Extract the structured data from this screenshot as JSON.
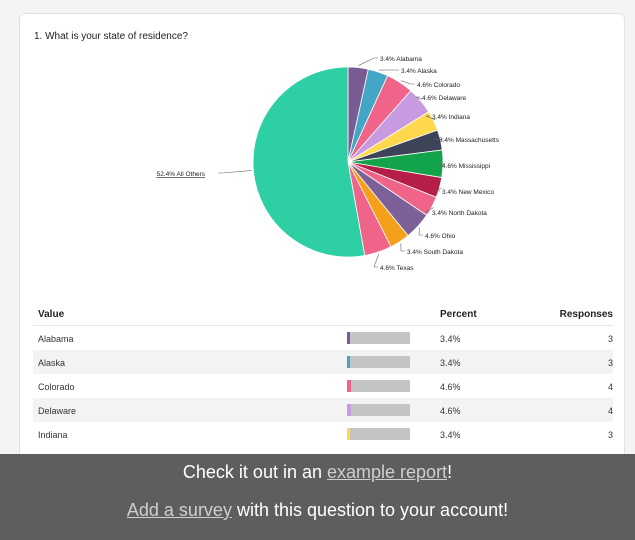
{
  "question": {
    "title": "1. What is your state of residence?"
  },
  "chart_data": {
    "type": "pie",
    "title": "1. What is your state of residence?",
    "slices": [
      {
        "label": "Alabama",
        "value": 3.4,
        "color": "#7a5c94"
      },
      {
        "label": "Alaska",
        "value": 3.4,
        "color": "#44a6c6"
      },
      {
        "label": "Colorado",
        "value": 4.6,
        "color": "#f0648a"
      },
      {
        "label": "Delaware",
        "value": 4.6,
        "color": "#c89be0"
      },
      {
        "label": "Indiana",
        "value": 3.4,
        "color": "#ffd84d"
      },
      {
        "label": "Massachusetts",
        "value": 3.4,
        "color": "#3e4458"
      },
      {
        "label": "Mississippi",
        "value": 4.6,
        "color": "#13a34b"
      },
      {
        "label": "New Mexico",
        "value": 3.4,
        "color": "#b51e46"
      },
      {
        "label": "North Dakota",
        "value": 3.4,
        "color": "#f0648a"
      },
      {
        "label": "Ohio",
        "value": 4.6,
        "color": "#7b6197"
      },
      {
        "label": "South Dakota",
        "value": 3.4,
        "color": "#f5a01a"
      },
      {
        "label": "Texas",
        "value": 4.6,
        "color": "#f0648a"
      },
      {
        "label": "All Others",
        "value": 52.4,
        "color": "#2ecfa4"
      }
    ],
    "slice_labels": [
      "3.4% Alabama",
      "3.4% Alaska",
      "4.6% Colorado",
      "4.6% Delaware",
      "3.4% Indiana",
      "3.4% Massachusetts",
      "4.6% Mississippi",
      "3.4% New Mexico",
      "3.4% North Dakota",
      "4.6% Ohio",
      "3.4% South Dakota",
      "4.6% Texas",
      "52.4% All Others"
    ]
  },
  "table": {
    "headers": {
      "value": "Value",
      "percent": "Percent",
      "responses": "Responses"
    },
    "rows": [
      {
        "value": "Alabama",
        "percent": "3.4%",
        "pct": 3.4,
        "responses": "3",
        "color": "#7a5c94"
      },
      {
        "value": "Alaska",
        "percent": "3.4%",
        "pct": 3.4,
        "responses": "3",
        "color": "#44a6c6"
      },
      {
        "value": "Colorado",
        "percent": "4.6%",
        "pct": 4.6,
        "responses": "4",
        "color": "#f0648a"
      },
      {
        "value": "Delaware",
        "percent": "4.6%",
        "pct": 4.6,
        "responses": "4",
        "color": "#c89be0"
      },
      {
        "value": "Indiana",
        "percent": "3.4%",
        "pct": 3.4,
        "responses": "3",
        "color": "#ffd84d"
      }
    ]
  },
  "footer": {
    "line1_pre": "Check it out in an ",
    "line1_link": "example report",
    "line1_post": "!",
    "line2_link": "Add a survey",
    "line2_post": " with this question to your account!"
  }
}
